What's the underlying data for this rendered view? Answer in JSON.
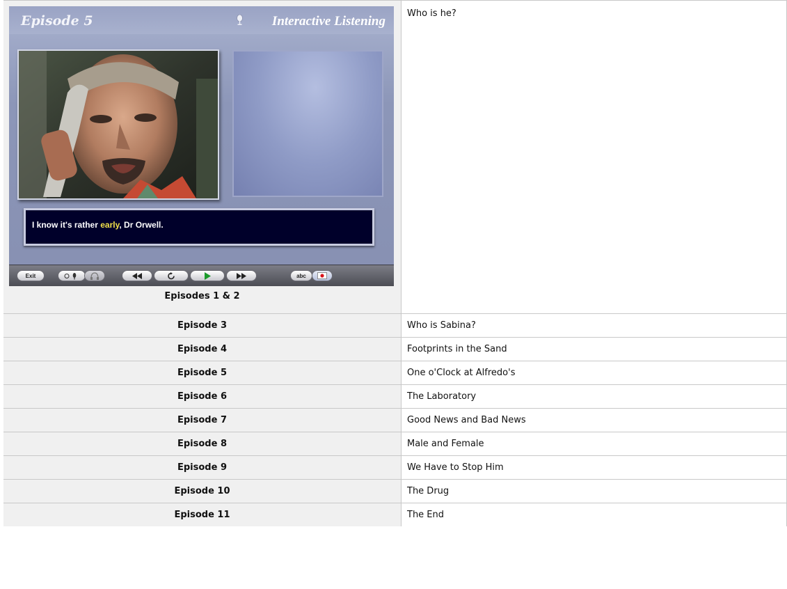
{
  "player": {
    "episode_title": "Episode 5",
    "app_title": "Interactive Listening",
    "caption_pre": "I know it's rather ",
    "caption_highlight": "early",
    "caption_post": ", Dr Orwell.",
    "exit_label": "Exit",
    "abc_label": "abc",
    "highlight_color": "#f2e14a"
  },
  "rows": [
    {
      "episode": "Episodes 1 & 2",
      "title": "Who is he?"
    },
    {
      "episode": "Episode 3",
      "title": "Who is Sabina?"
    },
    {
      "episode": "Episode 4",
      "title": "Footprints in the Sand"
    },
    {
      "episode": "Episode 5",
      "title": "One o'Clock at Alfredo's"
    },
    {
      "episode": "Episode 6",
      "title": "The Laboratory"
    },
    {
      "episode": "Episode 7",
      "title": "Good News and Bad News"
    },
    {
      "episode": "Episode 8",
      "title": "Male and Female"
    },
    {
      "episode": "Episode 9",
      "title": "We Have to Stop Him"
    },
    {
      "episode": "Episode 10",
      "title": "The Drug"
    },
    {
      "episode": "Episode 11",
      "title": "The End"
    }
  ]
}
